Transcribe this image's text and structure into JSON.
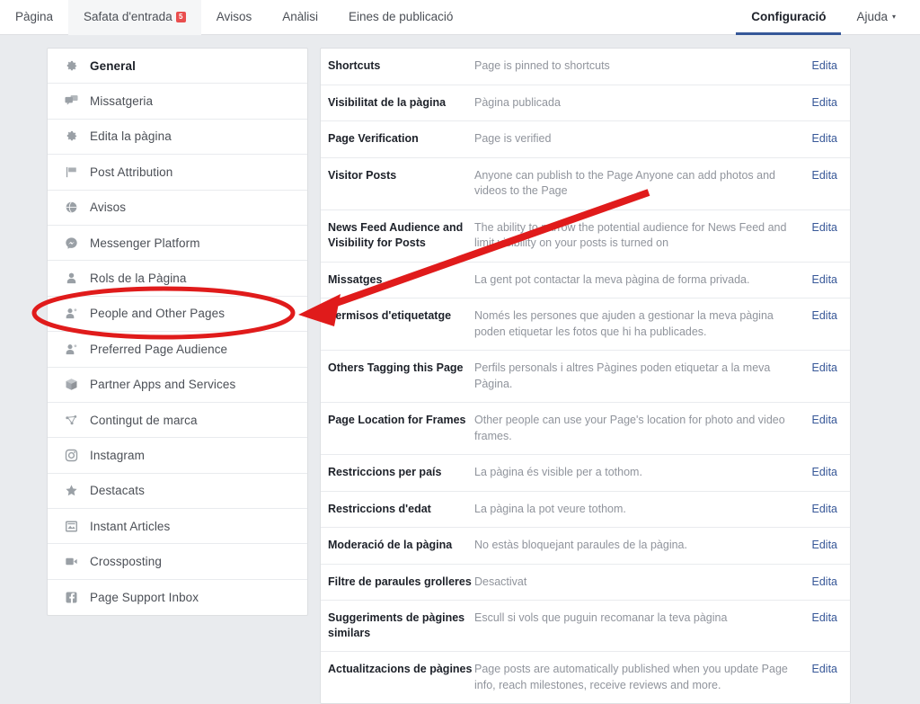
{
  "topnav": {
    "left_tabs": [
      {
        "label": "Pàgina",
        "state": "normal",
        "badge": null
      },
      {
        "label": "Safata d'entrada",
        "state": "hovered",
        "badge": "5"
      },
      {
        "label": "Avisos",
        "state": "normal",
        "badge": null
      },
      {
        "label": "Anàlisi",
        "state": "normal",
        "badge": null
      },
      {
        "label": "Eines de publicació",
        "state": "normal",
        "badge": null
      }
    ],
    "right_tabs": [
      {
        "label": "Configuració",
        "state": "active",
        "caret": false
      },
      {
        "label": "Ajuda",
        "state": "normal",
        "caret": true
      }
    ],
    "badge_color": "#e94e4e",
    "active_underline_color": "#365899"
  },
  "sidebar": {
    "items": [
      {
        "label": "General",
        "icon": "gear-icon",
        "selected": true
      },
      {
        "label": "Missatgeria",
        "icon": "chat-bubbles-icon",
        "selected": false
      },
      {
        "label": "Edita la pàgina",
        "icon": "gear-icon",
        "selected": false
      },
      {
        "label": "Post Attribution",
        "icon": "flag-icon",
        "selected": false
      },
      {
        "label": "Avisos",
        "icon": "globe-icon",
        "selected": false
      },
      {
        "label": "Messenger Platform",
        "icon": "messenger-icon",
        "selected": false
      },
      {
        "label": "Rols de la Pàgina",
        "icon": "person-icon",
        "selected": false
      },
      {
        "label": "People and Other Pages",
        "icon": "person-star-icon",
        "selected": false
      },
      {
        "label": "Preferred Page Audience",
        "icon": "person-star-icon",
        "selected": false
      },
      {
        "label": "Partner Apps and Services",
        "icon": "box-icon",
        "selected": false
      },
      {
        "label": "Contingut de marca",
        "icon": "branded-content-icon",
        "selected": false
      },
      {
        "label": "Instagram",
        "icon": "instagram-icon",
        "selected": false
      },
      {
        "label": "Destacats",
        "icon": "star-icon",
        "selected": false
      },
      {
        "label": "Instant Articles",
        "icon": "article-icon",
        "selected": false
      },
      {
        "label": "Crossposting",
        "icon": "video-camera-icon",
        "selected": false
      },
      {
        "label": "Page Support Inbox",
        "icon": "facebook-icon",
        "selected": false
      }
    ]
  },
  "main": {
    "edit_label": "Edita",
    "rows": [
      {
        "title": "Shortcuts",
        "desc": "Page is pinned to shortcuts"
      },
      {
        "title": "Visibilitat de la pàgina",
        "desc": "Pàgina publicada"
      },
      {
        "title": "Page Verification",
        "desc": "Page is verified"
      },
      {
        "title": "Visitor Posts",
        "desc": "Anyone can publish to the Page\nAnyone can add photos and videos to the Page"
      },
      {
        "title": "News Feed Audience and Visibility for Posts",
        "desc": "The ability to narrow the potential audience for News Feed and limit visibility on your posts is turned on"
      },
      {
        "title": "Missatges",
        "desc": "La gent pot contactar la meva pàgina de forma privada."
      },
      {
        "title": "Permisos d'etiquetatge",
        "desc": "Només les persones que ajuden a gestionar la meva pàgina poden etiquetar les fotos que hi ha publicades."
      },
      {
        "title": "Others Tagging this Page",
        "desc": "Perfils personals i altres Pàgines poden etiquetar a la meva Pàgina."
      },
      {
        "title": "Page Location for Frames",
        "desc": "Other people can use your Page's location for photo and video frames."
      },
      {
        "title": "Restriccions per país",
        "desc": "La pàgina és visible per a tothom."
      },
      {
        "title": "Restriccions d'edat",
        "desc": "La pàgina la pot veure tothom."
      },
      {
        "title": "Moderació de la pàgina",
        "desc": "No estàs bloquejant paraules de la pàgina."
      },
      {
        "title": "Filtre de paraules grolleres",
        "desc": "Desactivat"
      },
      {
        "title": "Suggeriments de pàgines similars",
        "desc": "Escull si vols que puguin recomanar la teva pàgina"
      },
      {
        "title": "Actualitzacions de pàgines",
        "desc": "Page posts are automatically published when you update Page info, reach milestones, receive reviews and more."
      }
    ]
  },
  "annotations": {
    "color": "#e01b1b",
    "ellipse": {
      "label": "highlight-ellipse-people-and-other-pages"
    },
    "arrow": {
      "label": "pointer-arrow"
    }
  }
}
